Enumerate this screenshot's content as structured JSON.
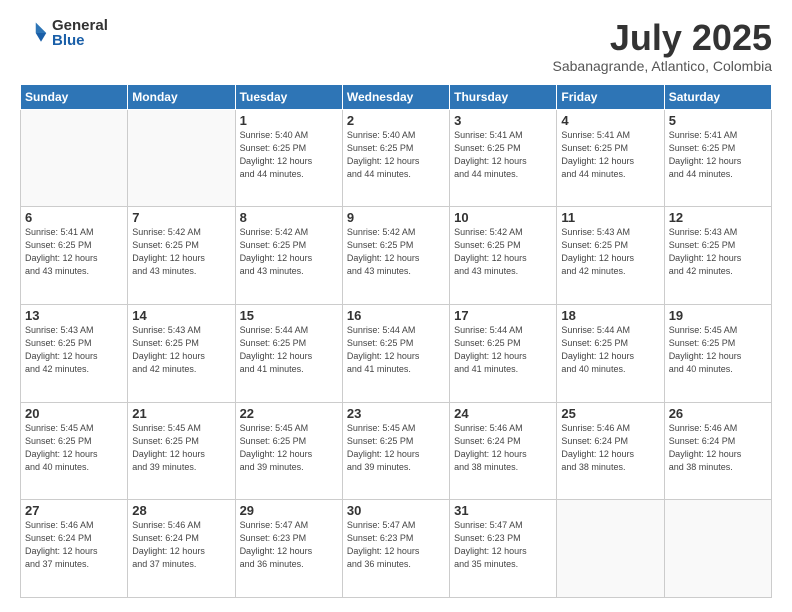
{
  "header": {
    "logo_general": "General",
    "logo_blue": "Blue",
    "month_title": "July 2025",
    "subtitle": "Sabanagrande, Atlantico, Colombia"
  },
  "days_of_week": [
    "Sunday",
    "Monday",
    "Tuesday",
    "Wednesday",
    "Thursday",
    "Friday",
    "Saturday"
  ],
  "weeks": [
    [
      {
        "day": "",
        "info": ""
      },
      {
        "day": "",
        "info": ""
      },
      {
        "day": "1",
        "info": "Sunrise: 5:40 AM\nSunset: 6:25 PM\nDaylight: 12 hours\nand 44 minutes."
      },
      {
        "day": "2",
        "info": "Sunrise: 5:40 AM\nSunset: 6:25 PM\nDaylight: 12 hours\nand 44 minutes."
      },
      {
        "day": "3",
        "info": "Sunrise: 5:41 AM\nSunset: 6:25 PM\nDaylight: 12 hours\nand 44 minutes."
      },
      {
        "day": "4",
        "info": "Sunrise: 5:41 AM\nSunset: 6:25 PM\nDaylight: 12 hours\nand 44 minutes."
      },
      {
        "day": "5",
        "info": "Sunrise: 5:41 AM\nSunset: 6:25 PM\nDaylight: 12 hours\nand 44 minutes."
      }
    ],
    [
      {
        "day": "6",
        "info": "Sunrise: 5:41 AM\nSunset: 6:25 PM\nDaylight: 12 hours\nand 43 minutes."
      },
      {
        "day": "7",
        "info": "Sunrise: 5:42 AM\nSunset: 6:25 PM\nDaylight: 12 hours\nand 43 minutes."
      },
      {
        "day": "8",
        "info": "Sunrise: 5:42 AM\nSunset: 6:25 PM\nDaylight: 12 hours\nand 43 minutes."
      },
      {
        "day": "9",
        "info": "Sunrise: 5:42 AM\nSunset: 6:25 PM\nDaylight: 12 hours\nand 43 minutes."
      },
      {
        "day": "10",
        "info": "Sunrise: 5:42 AM\nSunset: 6:25 PM\nDaylight: 12 hours\nand 43 minutes."
      },
      {
        "day": "11",
        "info": "Sunrise: 5:43 AM\nSunset: 6:25 PM\nDaylight: 12 hours\nand 42 minutes."
      },
      {
        "day": "12",
        "info": "Sunrise: 5:43 AM\nSunset: 6:25 PM\nDaylight: 12 hours\nand 42 minutes."
      }
    ],
    [
      {
        "day": "13",
        "info": "Sunrise: 5:43 AM\nSunset: 6:25 PM\nDaylight: 12 hours\nand 42 minutes."
      },
      {
        "day": "14",
        "info": "Sunrise: 5:43 AM\nSunset: 6:25 PM\nDaylight: 12 hours\nand 42 minutes."
      },
      {
        "day": "15",
        "info": "Sunrise: 5:44 AM\nSunset: 6:25 PM\nDaylight: 12 hours\nand 41 minutes."
      },
      {
        "day": "16",
        "info": "Sunrise: 5:44 AM\nSunset: 6:25 PM\nDaylight: 12 hours\nand 41 minutes."
      },
      {
        "day": "17",
        "info": "Sunrise: 5:44 AM\nSunset: 6:25 PM\nDaylight: 12 hours\nand 41 minutes."
      },
      {
        "day": "18",
        "info": "Sunrise: 5:44 AM\nSunset: 6:25 PM\nDaylight: 12 hours\nand 40 minutes."
      },
      {
        "day": "19",
        "info": "Sunrise: 5:45 AM\nSunset: 6:25 PM\nDaylight: 12 hours\nand 40 minutes."
      }
    ],
    [
      {
        "day": "20",
        "info": "Sunrise: 5:45 AM\nSunset: 6:25 PM\nDaylight: 12 hours\nand 40 minutes."
      },
      {
        "day": "21",
        "info": "Sunrise: 5:45 AM\nSunset: 6:25 PM\nDaylight: 12 hours\nand 39 minutes."
      },
      {
        "day": "22",
        "info": "Sunrise: 5:45 AM\nSunset: 6:25 PM\nDaylight: 12 hours\nand 39 minutes."
      },
      {
        "day": "23",
        "info": "Sunrise: 5:45 AM\nSunset: 6:25 PM\nDaylight: 12 hours\nand 39 minutes."
      },
      {
        "day": "24",
        "info": "Sunrise: 5:46 AM\nSunset: 6:24 PM\nDaylight: 12 hours\nand 38 minutes."
      },
      {
        "day": "25",
        "info": "Sunrise: 5:46 AM\nSunset: 6:24 PM\nDaylight: 12 hours\nand 38 minutes."
      },
      {
        "day": "26",
        "info": "Sunrise: 5:46 AM\nSunset: 6:24 PM\nDaylight: 12 hours\nand 38 minutes."
      }
    ],
    [
      {
        "day": "27",
        "info": "Sunrise: 5:46 AM\nSunset: 6:24 PM\nDaylight: 12 hours\nand 37 minutes."
      },
      {
        "day": "28",
        "info": "Sunrise: 5:46 AM\nSunset: 6:24 PM\nDaylight: 12 hours\nand 37 minutes."
      },
      {
        "day": "29",
        "info": "Sunrise: 5:47 AM\nSunset: 6:23 PM\nDaylight: 12 hours\nand 36 minutes."
      },
      {
        "day": "30",
        "info": "Sunrise: 5:47 AM\nSunset: 6:23 PM\nDaylight: 12 hours\nand 36 minutes."
      },
      {
        "day": "31",
        "info": "Sunrise: 5:47 AM\nSunset: 6:23 PM\nDaylight: 12 hours\nand 35 minutes."
      },
      {
        "day": "",
        "info": ""
      },
      {
        "day": "",
        "info": ""
      }
    ]
  ]
}
